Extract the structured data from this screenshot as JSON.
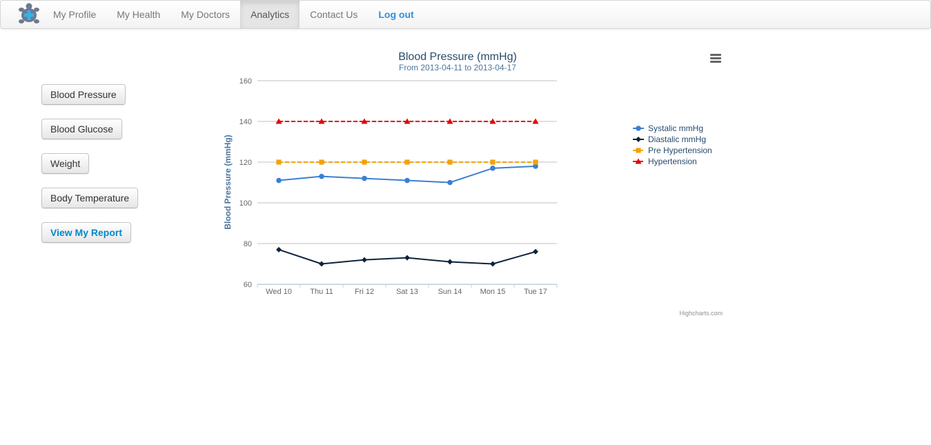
{
  "nav": {
    "items": [
      {
        "label": "My Profile",
        "name": "nav-my-profile"
      },
      {
        "label": "My Health",
        "name": "nav-my-health"
      },
      {
        "label": "My Doctors",
        "name": "nav-my-doctors"
      },
      {
        "label": "Analytics",
        "name": "nav-analytics",
        "active": true
      },
      {
        "label": "Contact Us",
        "name": "nav-contact-us"
      },
      {
        "label": "Log out",
        "name": "nav-log-out",
        "logout": true
      }
    ]
  },
  "sidebar": {
    "buttons": [
      {
        "label": "Blood Pressure",
        "name": "blood-pressure-button"
      },
      {
        "label": "Blood Glucose",
        "name": "blood-glucose-button"
      },
      {
        "label": "Weight",
        "name": "weight-button"
      },
      {
        "label": "Body Temperature",
        "name": "body-temperature-button"
      },
      {
        "label": "View My Report",
        "name": "view-my-report-button",
        "primary": true
      }
    ]
  },
  "chart_data": {
    "type": "line",
    "title": "Blood Pressure (mmHg)",
    "subtitle": "From 2013-04-11 to 2013-04-17",
    "ylabel": "Blood Pressure (mmHg)",
    "xlabel": "",
    "categories": [
      "Wed 10",
      "Thu 11",
      "Fri 12",
      "Sat 13",
      "Sun 14",
      "Mon 15",
      "Tue 17"
    ],
    "ylim": [
      60,
      160
    ],
    "yticks": [
      60,
      80,
      100,
      120,
      140,
      160
    ],
    "grid": true,
    "legend_position": "right",
    "credits": "Highcharts.com",
    "series": [
      {
        "name": "Systalic mmHg",
        "values": [
          111,
          113,
          112,
          111,
          110,
          117,
          118
        ],
        "color": "#3a7fd5",
        "marker": "circle",
        "dash": false
      },
      {
        "name": "Diastalic mmHg",
        "values": [
          77,
          70,
          72,
          73,
          71,
          70,
          76
        ],
        "color": "#0d233a",
        "marker": "diamond",
        "dash": false
      },
      {
        "name": "Pre Hypertension",
        "values": [
          120,
          120,
          120,
          120,
          120,
          120,
          120
        ],
        "color": "#f0a30a",
        "marker": "square",
        "dash": true
      },
      {
        "name": "Hypertension",
        "values": [
          140,
          140,
          140,
          140,
          140,
          140,
          140
        ],
        "color": "#e60000",
        "marker": "triangle",
        "dash": true
      }
    ]
  },
  "colors": {
    "title": "#274b6d",
    "subtitle": "#4d759e",
    "axis_label": "#4d759e",
    "tick_label": "#666666",
    "grid": "#c0c0c0",
    "menu_icon": "#666666"
  },
  "icons": {
    "brand": "turtle-logo-icon",
    "export_menu": "hamburger-menu-icon"
  }
}
